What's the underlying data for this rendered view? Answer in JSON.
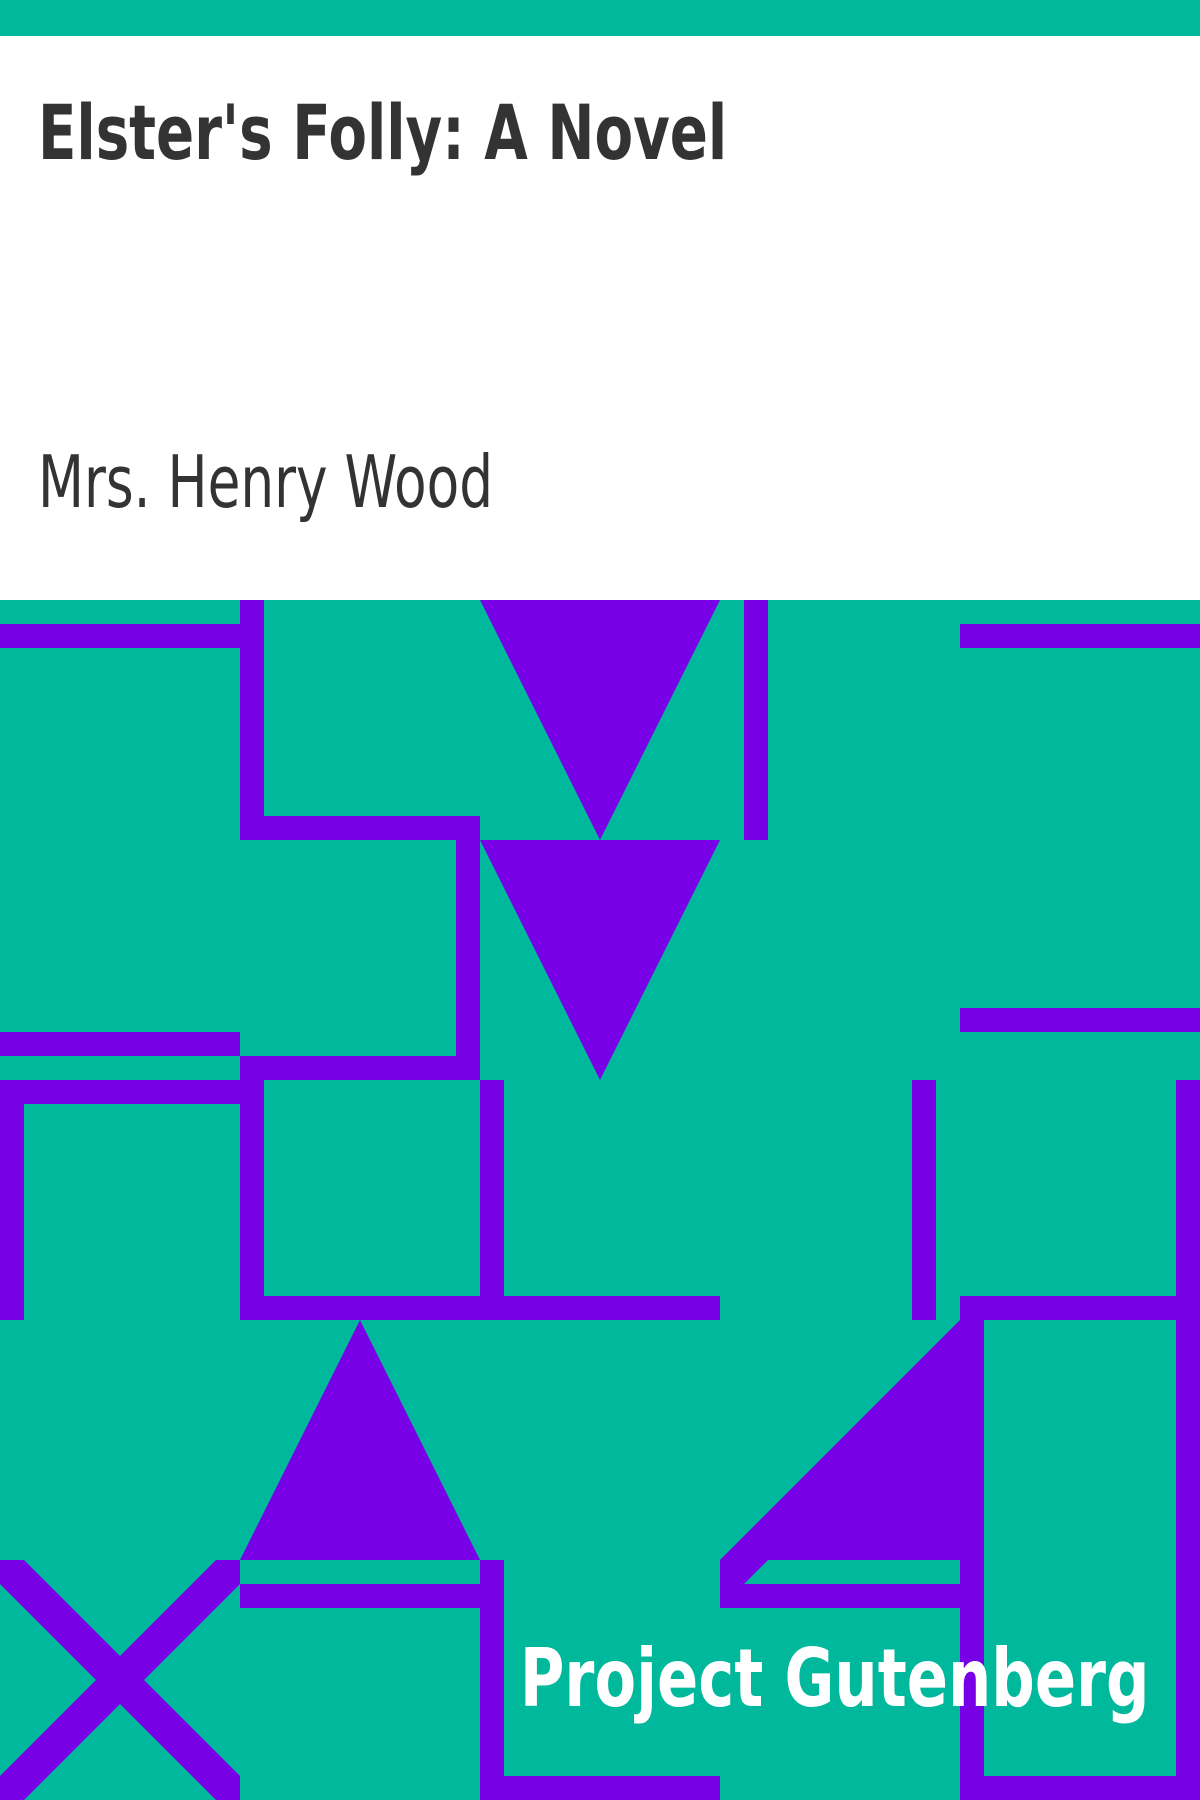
{
  "cover": {
    "title": "Elster's Folly: A Novel",
    "author": "Mrs. Henry Wood",
    "publisher": "Project Gutenberg"
  },
  "colors": {
    "background": "#00b89c",
    "panel": "#ffffff",
    "text": "#333333",
    "pattern": "#7700e6",
    "publisher_text": "#ffffff"
  }
}
